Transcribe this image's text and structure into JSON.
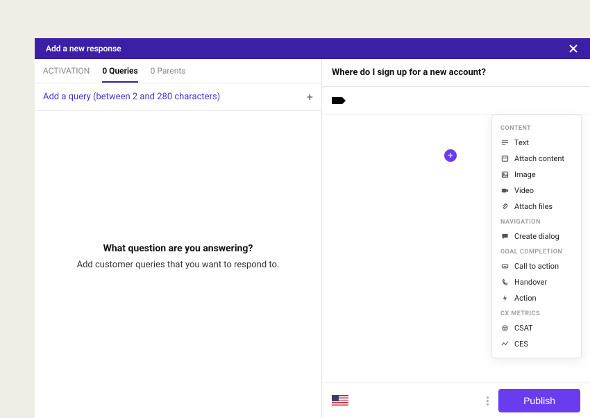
{
  "header": {
    "title": "Add a new response"
  },
  "tabs": {
    "activation": "ACTIVATION",
    "queries": "0 Queries",
    "parents": "0 Parents"
  },
  "query_input": {
    "placeholder": "Add a query (between 2 and 280 characters)"
  },
  "empty": {
    "title": "What question are you answering?",
    "subtitle": "Add customer queries that you want to respond to."
  },
  "answer": {
    "title": "Where do I sign up for a new account?"
  },
  "dropdown": {
    "sections": {
      "content": "CONTENT",
      "navigation": "NAVIGATION",
      "goal": "GOAL COMPLETION",
      "cx": "CX METRICS"
    },
    "items": {
      "text": "Text",
      "attach_content": "Attach content",
      "image": "Image",
      "video": "Video",
      "attach_files": "Attach files",
      "create_dialog": "Create dialog",
      "cta": "Call to action",
      "handover": "Handover",
      "action": "Action",
      "csat": "CSAT",
      "ces": "CES"
    }
  },
  "footer": {
    "publish": "Publish"
  }
}
